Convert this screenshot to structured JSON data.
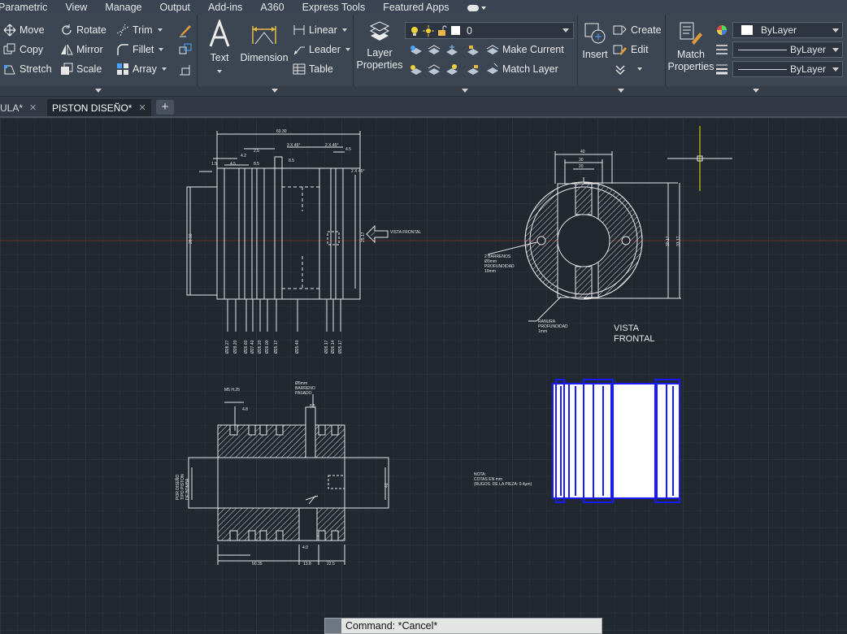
{
  "menu": [
    "Parametric",
    "View",
    "Manage",
    "Output",
    "Add-ins",
    "A360",
    "Express Tools",
    "Featured Apps"
  ],
  "modify": {
    "move": "Move",
    "rotate": "Rotate",
    "trim": "Trim",
    "copy": "Copy",
    "mirror": "Mirror",
    "fillet": "Fillet",
    "stretch": "Stretch",
    "scale": "Scale",
    "array": "Array"
  },
  "annotation": {
    "text": "Text",
    "dimension": "Dimension",
    "linear": "Linear",
    "leader": "Leader",
    "table": "Table"
  },
  "layers": {
    "layer_properties": "Layer\nProperties",
    "current_layer": "0",
    "make_current": "Make Current",
    "match_layer": "Match Layer"
  },
  "block": {
    "insert": "Insert",
    "create": "Create",
    "edit": "Edit"
  },
  "properties": {
    "match_properties": "Match\nProperties",
    "color": "ByLayer",
    "linetype": "ByLayer",
    "lineweight": "ByLayer"
  },
  "tabs": [
    {
      "label": "ULA*"
    },
    {
      "label": "PISTON DISEÑO*"
    }
  ],
  "drawing": {
    "vista_frontal": "VISTA\nFRONTAL",
    "arrow_label": "VISTA\nFRONTAL"
  },
  "command": {
    "text": "Command: *Cancel*"
  },
  "colors": {
    "background": "#212830",
    "ribbon": "#3c4552",
    "crosshair": "#e6e600",
    "solid": "#1a1aff"
  }
}
